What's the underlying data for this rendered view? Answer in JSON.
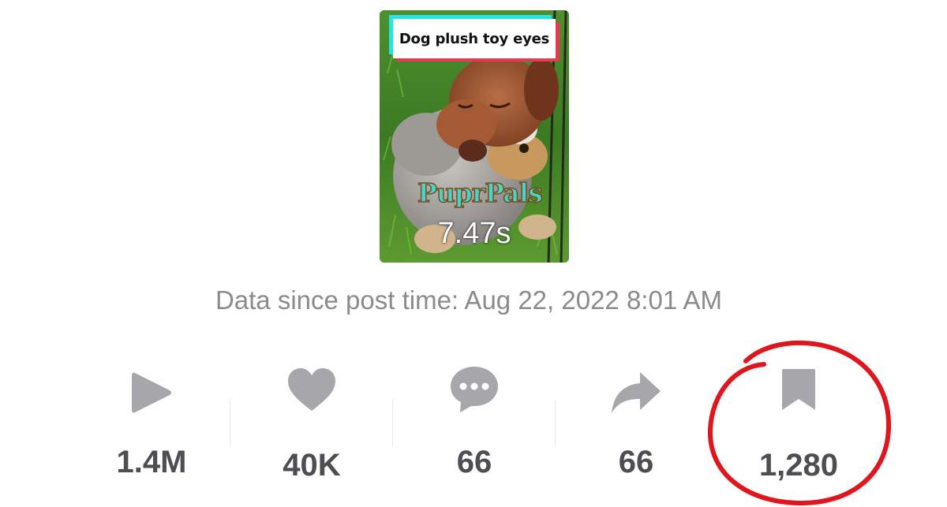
{
  "video": {
    "caption": "Dog plush toy eyes",
    "logo_text": "PuprPals",
    "duration": "7.47s"
  },
  "data_since": "Data since post time: Aug 22, 2022 8:01 AM",
  "stats": {
    "plays": {
      "icon": "play-icon",
      "value": "1.4M"
    },
    "likes": {
      "icon": "heart-icon",
      "value": "40K"
    },
    "comments": {
      "icon": "comment-icon",
      "value": "66"
    },
    "shares": {
      "icon": "share-icon",
      "value": "66"
    },
    "saves": {
      "icon": "bookmark-icon",
      "value": "1,280"
    }
  },
  "colors": {
    "icon_gray": "#a7a7ab",
    "value_gray": "#4d4d52",
    "caption_cyan": "#25e3e6",
    "caption_red": "#e53a52",
    "annotation_red": "#e0161e"
  }
}
